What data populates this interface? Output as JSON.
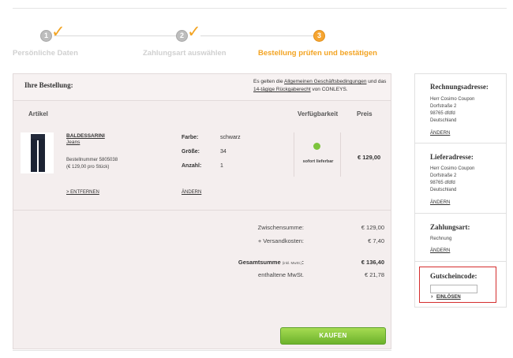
{
  "steps": [
    {
      "number": "1",
      "label": "Persönliche Daten",
      "done": true
    },
    {
      "number": "2",
      "label": "Zahlungsart auswählen",
      "done": true
    },
    {
      "number": "3",
      "label": "Bestellung prüfen und bestätigen",
      "done": false
    }
  ],
  "check_icon": "✓",
  "order": {
    "title": "Ihre Bestellung:",
    "terms_pre": "Es gelten die ",
    "terms_link1": "Allgemeinen Geschäftsbedingungen",
    "terms_mid": " und das ",
    "terms_link2": "14-tägige Rückgaberecht",
    "terms_post": " von CONLEYS.",
    "columns": {
      "article": "Artikel",
      "availability": "Verfügbarkeit",
      "price": "Preis"
    }
  },
  "item": {
    "brand": "BALDESSARINI",
    "name": "Jeans",
    "article_number": "Bestellnummer 5805038",
    "unit_price": "(€ 129,00 pro Stück)",
    "remove_label": "> ENTFERNEN",
    "attributes": [
      {
        "label": "Farbe:",
        "value": "schwarz"
      },
      {
        "label": "Größe:",
        "value": "34"
      },
      {
        "label": "Anzahl:",
        "value": "1"
      }
    ],
    "change_label": "ÄNDERN",
    "availability": "sofort lieferbar",
    "availability_color": "#7dc43d",
    "price": "€ 129,00",
    "image_icon": "jeans-icon"
  },
  "summary": {
    "subtotal_label": "Zwischensumme:",
    "subtotal_value": "€ 129,00",
    "shipping_label": "+ Versandkosten:",
    "shipping_value": "€ 7,40",
    "total_label": "Gesamtsumme",
    "total_note": "(inkl. MwSt.)",
    "total_suffix": ":",
    "total_value": "€ 136,40",
    "vat_label": "enthaltene MwSt.",
    "vat_value": "€ 21,78"
  },
  "buy_button": "KAUFEN",
  "buy_button_color": "#7cc036",
  "sidebar": {
    "billing": {
      "title": "Rechnungsadresse:",
      "lines": [
        "Herr Cosimo Coupon",
        "Dorfstraße 2",
        "98765 dfdfd",
        "Deutschland"
      ],
      "change": "ÄNDERN"
    },
    "delivery": {
      "title": "Lieferadresse:",
      "lines": [
        "Herr Cosimo Coupon",
        "Dorfstraße 2",
        "98765 dfdfd",
        "Deutschland"
      ],
      "change": "ÄNDERN"
    },
    "payment": {
      "title": "Zahlungsart:",
      "method": "Rechnung",
      "change": "ÄNDERN"
    },
    "coupon": {
      "title": "Gutscheincode:",
      "input_value": "",
      "redeem_arrow": "›",
      "redeem": "EINLÖSEN",
      "highlight_color": "#d42d2d"
    }
  },
  "accent_color": "#f3a423"
}
